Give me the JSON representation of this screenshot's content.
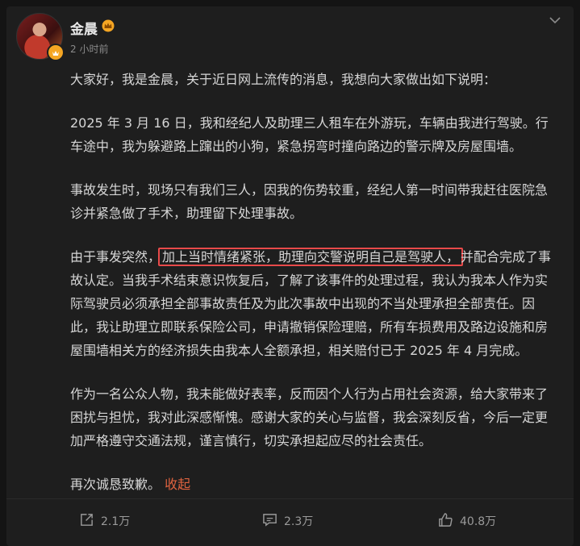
{
  "post": {
    "author": "金晨",
    "time": "2 小时前",
    "paragraphs": {
      "p1": "大家好，我是金晨，关于近日网上流传的消息，我想向大家做出如下说明：",
      "p2": "2025 年 3 月 16 日，我和经纪人及助理三人租车在外游玩，车辆由我进行驾驶。行车途中，我为躲避路上蹿出的小狗，紧急拐弯时撞向路边的警示牌及房屋围墙。",
      "p3": "事故发生时，现场只有我们三人，因我的伤势较重，经纪人第一时间带我赶往医院急诊并紧急做了手术，助理留下处理事故。",
      "p4_before": "由于事发突然，",
      "p4_highlight": "加上当时情绪紧张，助理向交警说明自己是驾驶人，",
      "p4_after": "并配合完成了事故认定。当我手术结束意识恢复后，了解了该事件的处理过程，我认为我本人作为实际驾驶员必须承担全部事故责任及为此次事故中出现的不当处理承担全部责任。因此，我让助理立即联系保险公司，申请撤销保险理赔，所有车损费用及路边设施和房屋围墙相关方的经济损失由我本人全额承担，相关赔付已于 2025 年 4 月完成。",
      "p5": "作为一名公众人物，我未能做好表率，反而因个人行为占用社会资源，给大家带来了困扰与担忧，我对此深感惭愧。感谢大家的关心与监督，我会深刻反省，今后一定更加严格遵守交通法规，谨言慎行，切实承担起应尽的社会责任。",
      "p6": "再次诚恳致歉。"
    },
    "collapse_label": "收起"
  },
  "actions": {
    "share_count": "2.1万",
    "comment_count": "2.3万",
    "like_count": "40.8万"
  },
  "icons": {
    "avatar_badge": "verified-badge-icon",
    "crown": "crown-icon",
    "menu": "chevron-down-icon",
    "share": "share-icon",
    "comment": "comment-icon",
    "like": "thumbs-up-icon"
  },
  "colors": {
    "background": "#141414",
    "card": "#1e1e1e",
    "highlight_border": "#e84a4a",
    "accent": "#e0633f",
    "badge": "#f5a623"
  }
}
